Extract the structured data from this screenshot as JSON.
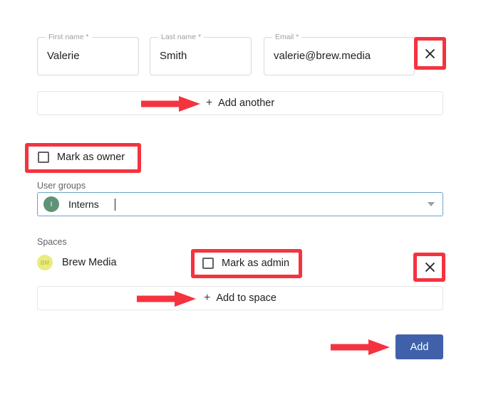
{
  "form": {
    "fields": [
      {
        "label": "First name *",
        "value": "Valerie",
        "name": "first-name"
      },
      {
        "label": "Last name *",
        "value": "Smith",
        "name": "last-name"
      },
      {
        "label": "Email *",
        "value": "valerie@brew.media",
        "name": "email"
      }
    ],
    "remove_person_icon": "close-icon",
    "add_another": {
      "plus": "+",
      "label": "Add another"
    },
    "mark_as_owner": {
      "label": "Mark as owner",
      "checked": false
    },
    "user_groups": {
      "caption": "User groups",
      "chip": {
        "initial": "I",
        "name": "Interns"
      },
      "caret_icon": "chevron-down-icon"
    },
    "spaces": {
      "caption": "Spaces",
      "space": {
        "initials": "BM",
        "name": "Brew Media"
      },
      "mark_as_admin": {
        "label": "Mark as admin",
        "checked": false
      },
      "remove_space_icon": "close-icon",
      "add_to_space": {
        "plus": "+",
        "label": "Add to space"
      }
    },
    "submit": {
      "label": "Add"
    }
  },
  "annotations": {
    "color": "#f5333f",
    "boxes": [
      "remove-person-button",
      "mark-as-owner-checkbox",
      "mark-as-admin-checkbox",
      "remove-space-button"
    ],
    "arrows": [
      "add-another-button",
      "add-to-space-button",
      "add-button"
    ]
  }
}
